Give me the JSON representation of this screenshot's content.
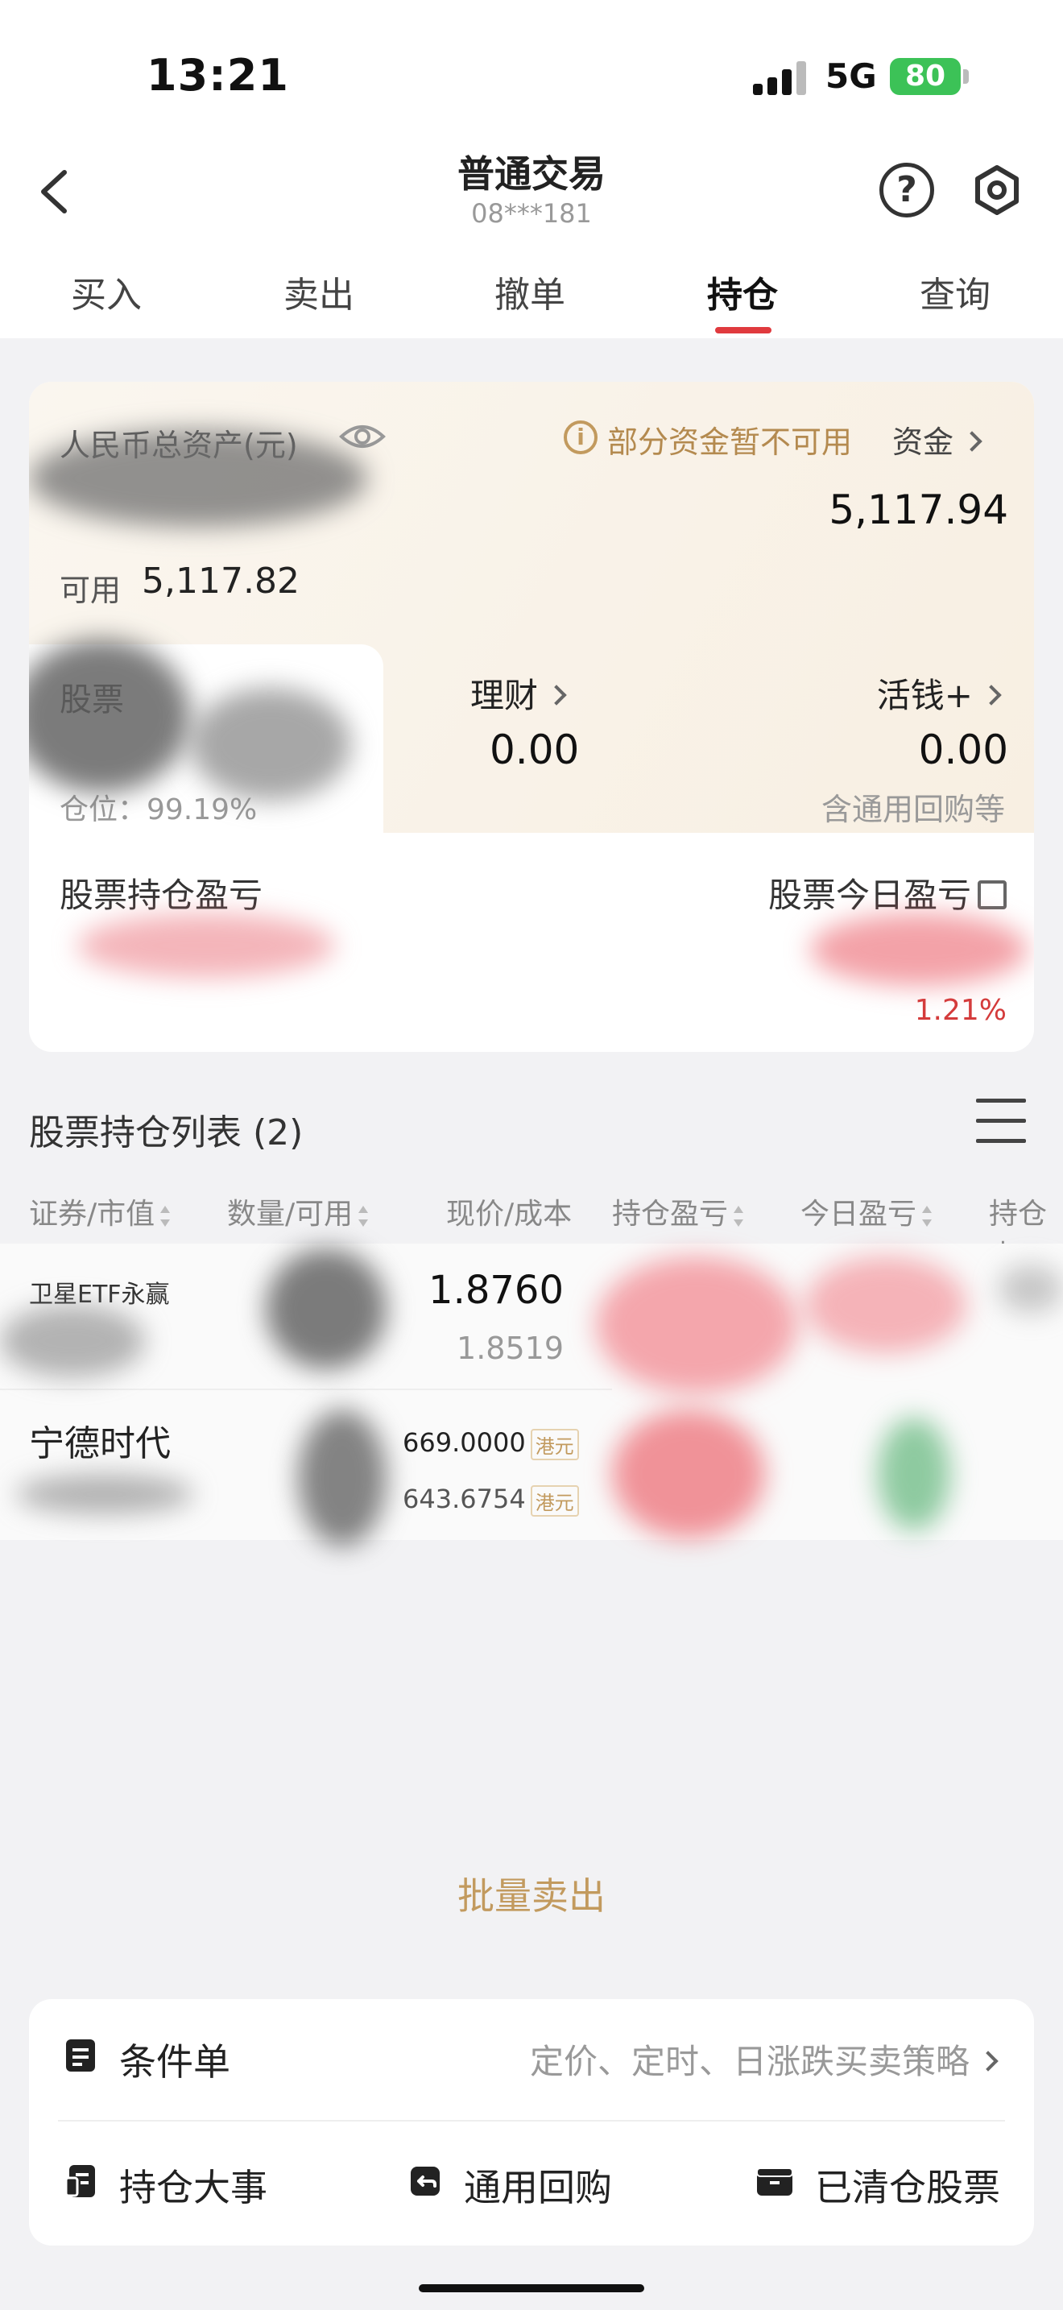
{
  "status_bar": {
    "time": "13:21",
    "network": "5G",
    "battery": "80"
  },
  "header": {
    "title": "普通交易",
    "account": "08***181",
    "tabs": [
      {
        "label": "买入"
      },
      {
        "label": "卖出"
      },
      {
        "label": "撤单"
      },
      {
        "label": "持仓",
        "active": true
      },
      {
        "label": "查询"
      }
    ]
  },
  "assets": {
    "total_label": "人民币总资产(元)",
    "notice": "部分资金暂不可用",
    "funds_link": "资金",
    "total_value": "5,117.94",
    "available_label": "可用",
    "available_value": "5,117.82",
    "stock_label": "股票",
    "position_ratio": "仓位：99.19%",
    "wealth_label": "理财",
    "wealth_value": "0.00",
    "cash_label": "活钱+",
    "cash_value": "0.00",
    "cash_note": "含通用回购等",
    "holding_pl_label": "股票持仓盈亏",
    "today_pl_label": "股票今日盈亏",
    "today_pl_pct": "1.21%"
  },
  "holdings": {
    "title": "股票持仓列表 (2)",
    "columns": [
      "证券/市值",
      "数量/可用",
      "现价/成本",
      "持仓盈亏",
      "今日盈亏",
      "持仓占"
    ],
    "rows": [
      {
        "name": "卫星ETF永赢",
        "price": "1.8760",
        "cost": "1.8519"
      },
      {
        "name": "宁德时代",
        "price": "669.0000",
        "cost": "643.6754",
        "currency": "港元"
      }
    ]
  },
  "batch_sell": "批量卖出",
  "tools": {
    "condition_label": "条件单",
    "condition_desc": "定价、定时、日涨跌买卖策略",
    "items": [
      "持仓大事",
      "通用回购",
      "已清仓股票"
    ]
  },
  "colors": {
    "accent": "#e03a3e",
    "gold": "#c29a5e",
    "loss": "#3aa86b"
  }
}
